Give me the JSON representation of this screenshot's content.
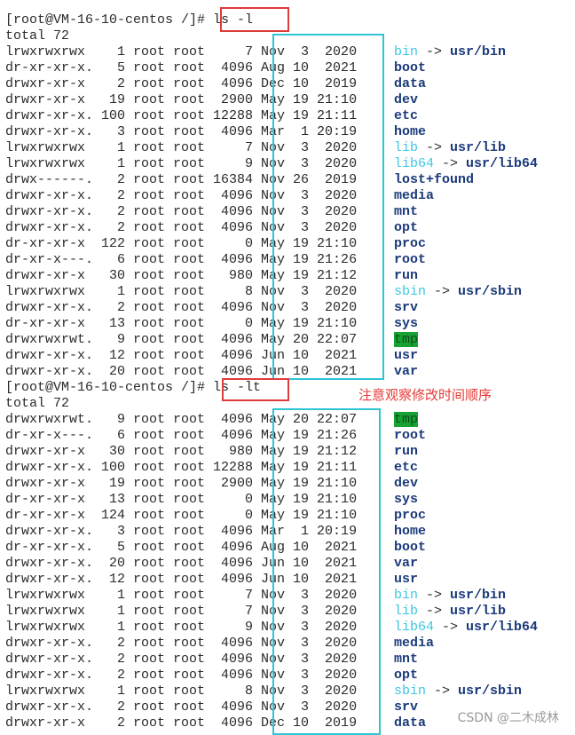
{
  "colors": {
    "link": "#3cc8e0",
    "dir": "#1b3a7a",
    "tmp_bg": "#19a234",
    "highlight_red": "#e03b3b",
    "highlight_cyan": "#2ec5d3",
    "annotation": "#e53935"
  },
  "icons": [
    "terminal"
  ],
  "terminal": {
    "prompt": "[root@VM-16-10-centos /]# ",
    "commands": [
      "ls -l",
      "ls -lt"
    ],
    "blocks": [
      {
        "total": "total 72",
        "rows": [
          {
            "meta": "lrwxrwxrwx    1 root root     7 Nov  3  2020 ",
            "name": "bin",
            "type": "link",
            "target": "usr/bin"
          },
          {
            "meta": "dr-xr-xr-x.   5 root root  4096 Aug 10  2021 ",
            "name": "boot",
            "type": "dir"
          },
          {
            "meta": "drwxr-xr-x    2 root root  4096 Dec 10  2019 ",
            "name": "data",
            "type": "dir"
          },
          {
            "meta": "drwxr-xr-x   19 root root  2900 May 19 21:10 ",
            "name": "dev",
            "type": "dir"
          },
          {
            "meta": "drwxr-xr-x. 100 root root 12288 May 19 21:11 ",
            "name": "etc",
            "type": "dir"
          },
          {
            "meta": "drwxr-xr-x.   3 root root  4096 Mar  1 20:19 ",
            "name": "home",
            "type": "dir"
          },
          {
            "meta": "lrwxrwxrwx    1 root root     7 Nov  3  2020 ",
            "name": "lib",
            "type": "link",
            "target": "usr/lib"
          },
          {
            "meta": "lrwxrwxrwx    1 root root     9 Nov  3  2020 ",
            "name": "lib64",
            "type": "link",
            "target": "usr/lib64"
          },
          {
            "meta": "drwx------.   2 root root 16384 Nov 26  2019 ",
            "name": "lost+found",
            "type": "dir"
          },
          {
            "meta": "drwxr-xr-x.   2 root root  4096 Nov  3  2020 ",
            "name": "media",
            "type": "dir"
          },
          {
            "meta": "drwxr-xr-x.   2 root root  4096 Nov  3  2020 ",
            "name": "mnt",
            "type": "dir"
          },
          {
            "meta": "drwxr-xr-x.   2 root root  4096 Nov  3  2020 ",
            "name": "opt",
            "type": "dir"
          },
          {
            "meta": "dr-xr-xr-x  122 root root     0 May 19 21:10 ",
            "name": "proc",
            "type": "dir"
          },
          {
            "meta": "dr-xr-x---.   6 root root  4096 May 19 21:26 ",
            "name": "root",
            "type": "dir"
          },
          {
            "meta": "drwxr-xr-x   30 root root   980 May 19 21:12 ",
            "name": "run",
            "type": "dir"
          },
          {
            "meta": "lrwxrwxrwx    1 root root     8 Nov  3  2020 ",
            "name": "sbin",
            "type": "link",
            "target": "usr/sbin"
          },
          {
            "meta": "drwxr-xr-x.   2 root root  4096 Nov  3  2020 ",
            "name": "srv",
            "type": "dir"
          },
          {
            "meta": "dr-xr-xr-x   13 root root     0 May 19 21:10 ",
            "name": "sys",
            "type": "dir"
          },
          {
            "meta": "drwxrwxrwt.   9 root root  4096 May 20 22:07 ",
            "name": "tmp",
            "type": "tmp"
          },
          {
            "meta": "drwxr-xr-x.  12 root root  4096 Jun 10  2021 ",
            "name": "usr",
            "type": "dir"
          },
          {
            "meta": "drwxr-xr-x.  20 root root  4096 Jun 10  2021 ",
            "name": "var",
            "type": "dir"
          }
        ]
      },
      {
        "total": "total 72",
        "rows": [
          {
            "meta": "drwxrwxrwt.   9 root root  4096 May 20 22:07 ",
            "name": "tmp",
            "type": "tmp"
          },
          {
            "meta": "dr-xr-x---.   6 root root  4096 May 19 21:26 ",
            "name": "root",
            "type": "dir"
          },
          {
            "meta": "drwxr-xr-x   30 root root   980 May 19 21:12 ",
            "name": "run",
            "type": "dir"
          },
          {
            "meta": "drwxr-xr-x. 100 root root 12288 May 19 21:11 ",
            "name": "etc",
            "type": "dir"
          },
          {
            "meta": "drwxr-xr-x   19 root root  2900 May 19 21:10 ",
            "name": "dev",
            "type": "dir"
          },
          {
            "meta": "dr-xr-xr-x   13 root root     0 May 19 21:10 ",
            "name": "sys",
            "type": "dir"
          },
          {
            "meta": "dr-xr-xr-x  124 root root     0 May 19 21:10 ",
            "name": "proc",
            "type": "dir"
          },
          {
            "meta": "drwxr-xr-x.   3 root root  4096 Mar  1 20:19 ",
            "name": "home",
            "type": "dir"
          },
          {
            "meta": "dr-xr-xr-x.   5 root root  4096 Aug 10  2021 ",
            "name": "boot",
            "type": "dir"
          },
          {
            "meta": "drwxr-xr-x.  20 root root  4096 Jun 10  2021 ",
            "name": "var",
            "type": "dir"
          },
          {
            "meta": "drwxr-xr-x.  12 root root  4096 Jun 10  2021 ",
            "name": "usr",
            "type": "dir"
          },
          {
            "meta": "lrwxrwxrwx    1 root root     7 Nov  3  2020 ",
            "name": "bin",
            "type": "link",
            "target": "usr/bin"
          },
          {
            "meta": "lrwxrwxrwx    1 root root     7 Nov  3  2020 ",
            "name": "lib",
            "type": "link",
            "target": "usr/lib"
          },
          {
            "meta": "lrwxrwxrwx    1 root root     9 Nov  3  2020 ",
            "name": "lib64",
            "type": "link",
            "target": "usr/lib64"
          },
          {
            "meta": "drwxr-xr-x.   2 root root  4096 Nov  3  2020 ",
            "name": "media",
            "type": "dir"
          },
          {
            "meta": "drwxr-xr-x.   2 root root  4096 Nov  3  2020 ",
            "name": "mnt",
            "type": "dir"
          },
          {
            "meta": "drwxr-xr-x.   2 root root  4096 Nov  3  2020 ",
            "name": "opt",
            "type": "dir"
          },
          {
            "meta": "lrwxrwxrwx    1 root root     8 Nov  3  2020 ",
            "name": "sbin",
            "type": "link",
            "target": "usr/sbin"
          },
          {
            "meta": "drwxr-xr-x.   2 root root  4096 Nov  3  2020 ",
            "name": "srv",
            "type": "dir"
          },
          {
            "meta": "drwxr-xr-x    2 root root  4096 Dec 10  2019 ",
            "name": "data",
            "type": "dir"
          }
        ]
      }
    ]
  },
  "annotation": "注意观察修改时间顺序",
  "watermark": "CSDN @二木成林"
}
